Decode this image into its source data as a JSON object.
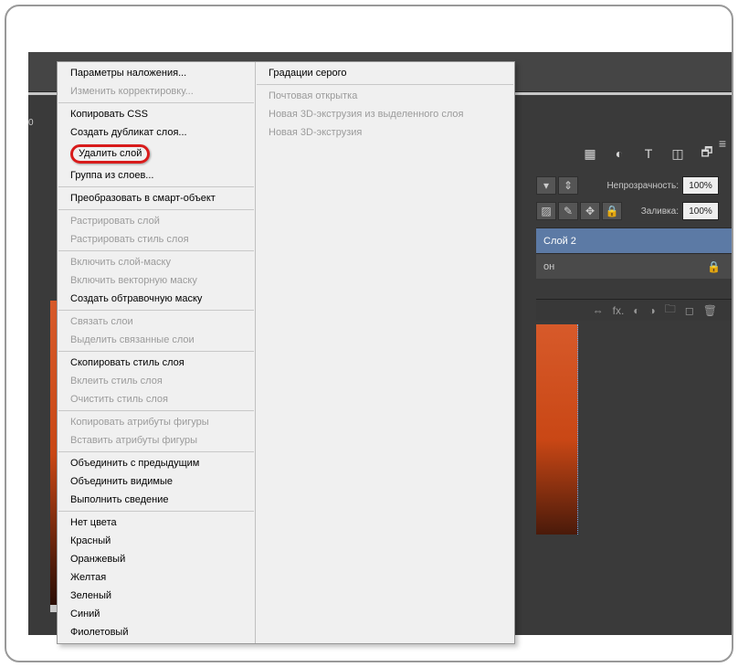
{
  "menu": {
    "col1_group1": [
      {
        "label": "Параметры наложения...",
        "enabled": true
      },
      {
        "label": "Изменить корректировку...",
        "enabled": false
      }
    ],
    "col1_group2": [
      {
        "label": "Копировать CSS",
        "enabled": true
      },
      {
        "label": "Создать дубликат слоя...",
        "enabled": true
      }
    ],
    "delete_layer": "Удалить слой",
    "col1_group2b": [
      {
        "label": "Группа из слоев...",
        "enabled": true
      }
    ],
    "col1_group3": [
      {
        "label": "Преобразовать в смарт-объект",
        "enabled": true
      }
    ],
    "col1_group4": [
      {
        "label": "Растрировать слой",
        "enabled": false
      },
      {
        "label": "Растрировать стиль слоя",
        "enabled": false
      }
    ],
    "col1_group5": [
      {
        "label": "Включить слой-маску",
        "enabled": false
      },
      {
        "label": "Включить векторную маску",
        "enabled": false
      },
      {
        "label": "Создать обтравочную маску",
        "enabled": true
      }
    ],
    "col1_group6": [
      {
        "label": "Связать слои",
        "enabled": false
      },
      {
        "label": "Выделить связанные слои",
        "enabled": false
      }
    ],
    "col1_group7": [
      {
        "label": "Скопировать стиль слоя",
        "enabled": true
      },
      {
        "label": "Вклеить стиль слоя",
        "enabled": false
      },
      {
        "label": "Очистить стиль слоя",
        "enabled": false
      }
    ],
    "col1_group8": [
      {
        "label": "Копировать атрибуты фигуры",
        "enabled": false
      },
      {
        "label": "Вставить атрибуты фигуры",
        "enabled": false
      }
    ],
    "col1_group9": [
      {
        "label": "Объединить с предыдущим",
        "enabled": true
      },
      {
        "label": "Объединить видимые",
        "enabled": true
      },
      {
        "label": "Выполнить сведение",
        "enabled": true
      }
    ],
    "col1_colors": [
      {
        "label": "Нет цвета",
        "enabled": true
      },
      {
        "label": "Красный",
        "enabled": true
      },
      {
        "label": "Оранжевый",
        "enabled": true
      },
      {
        "label": "Желтая",
        "enabled": true
      },
      {
        "label": "Зеленый",
        "enabled": true
      },
      {
        "label": "Синий",
        "enabled": true
      },
      {
        "label": "Фиолетовый",
        "enabled": true
      }
    ],
    "col2_top": {
      "label": "Градации серого",
      "enabled": true
    },
    "col2_rest": [
      {
        "label": "Почтовая открытка",
        "enabled": false
      },
      {
        "label": "Новая 3D-экструзия из выделенного слоя",
        "enabled": false
      },
      {
        "label": "Новая 3D-экструзия",
        "enabled": false
      }
    ]
  },
  "panel": {
    "opacity_label": "Непрозрачность:",
    "opacity_value": "100%",
    "fill_label": "Заливка:",
    "fill_value": "100%",
    "layer_name": "Слой 2",
    "bg_part": "он",
    "icons": {
      "link": "⇔",
      "fx": "fx.",
      "mask": "◐",
      "adj": "◑",
      "folder": "🗀",
      "trash": "🗑"
    }
  },
  "strip_number": "0"
}
